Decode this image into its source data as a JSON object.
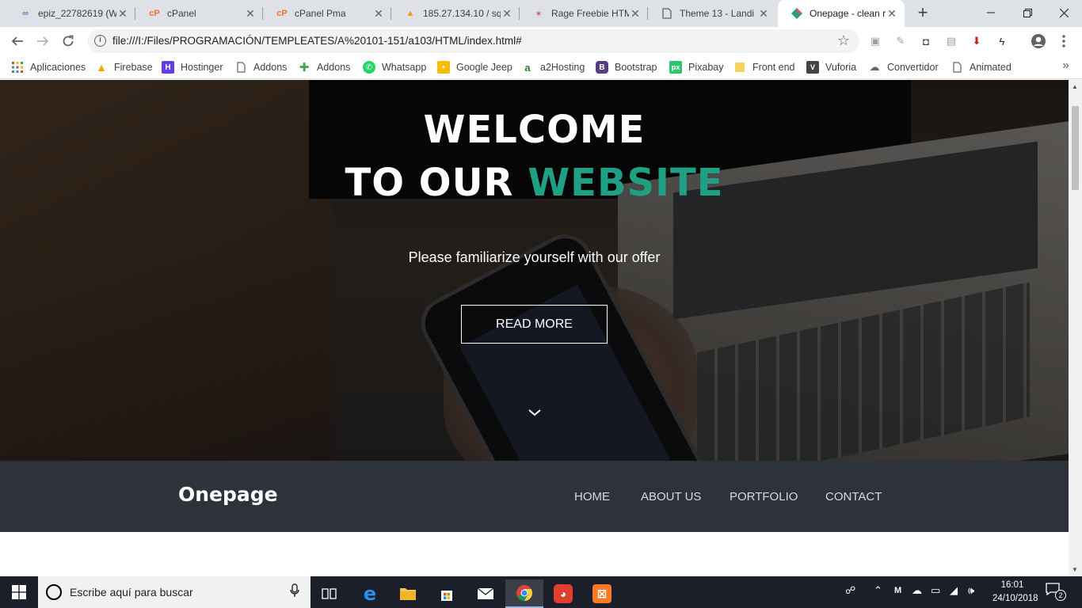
{
  "browser": {
    "tabs": [
      {
        "title": "epiz_22782619 (W",
        "icon": "infinity-icon",
        "icon_color": "#7b6fd6"
      },
      {
        "title": "cPanel",
        "icon": "cpanel-icon",
        "icon_color": "#ff6c2c"
      },
      {
        "title": "cPanel Pma",
        "icon": "cpanel-icon",
        "icon_color": "#ff6c2c"
      },
      {
        "title": "185.27.134.10 / sq",
        "icon": "phpmyadmin-icon",
        "icon_color": "#f89c0e"
      },
      {
        "title": "Rage Freebie HTM",
        "icon": "rage-icon",
        "icon_color": "#c44b9a"
      },
      {
        "title": "Theme 13 - Landi",
        "icon": "document-icon",
        "icon_color": "#5f6368"
      },
      {
        "title": "Onepage - clean r",
        "icon": "onepage-icon",
        "icon_color": "#1f9f83"
      }
    ],
    "active_tab_index": 6,
    "new_tab_symbol": "+",
    "address": "file:///I:/Files/PROGRAMACIÓN/TEMPLEATES/A%20101-151/a103/HTML/index.html#",
    "bookmarks": [
      {
        "label": "Aplicaciones",
        "icon": "apps-grid-icon",
        "color": "#4285f4"
      },
      {
        "label": "Firebase",
        "icon": "firebase-icon",
        "color": "#ffa000"
      },
      {
        "label": "Hostinger",
        "icon": "hostinger-icon",
        "color": "#673de6"
      },
      {
        "label": "Addons",
        "icon": "page-icon",
        "color": "#5f6368"
      },
      {
        "label": "Addons",
        "icon": "puzzle-icon",
        "color": "#3aa757"
      },
      {
        "label": "Whatsapp",
        "icon": "whatsapp-icon",
        "color": "#25d366"
      },
      {
        "label": "Google Jeep",
        "icon": "keep-icon",
        "color": "#fbbc04"
      },
      {
        "label": "a2Hosting",
        "icon": "a2-icon",
        "color": "#2e7d32"
      },
      {
        "label": "Bootstrap",
        "icon": "bootstrap-icon",
        "color": "#563d7c"
      },
      {
        "label": "Pixabay",
        "icon": "pixabay-icon",
        "color": "#2ec66d"
      },
      {
        "label": "Front end",
        "icon": "folder-icon",
        "color": "#f4d35e"
      },
      {
        "label": "Vuforia",
        "icon": "vuforia-icon",
        "color": "#444444"
      },
      {
        "label": "Convertidor",
        "icon": "cloud-icon",
        "color": "#666666"
      },
      {
        "label": "Animated",
        "icon": "page-icon",
        "color": "#5f6368"
      }
    ],
    "bookmarks_more": "»"
  },
  "page": {
    "hero": {
      "title_line1": "WELCOME",
      "title_line2_plain": "TO OUR ",
      "title_line2_accent": "WEBSITE",
      "subtitle": "Please familiarize yourself with our offer",
      "button": "READ MORE",
      "accent_color": "#1f9f83"
    },
    "navbar": {
      "brand": "Onepage",
      "links": [
        "HOME",
        "ABOUT US",
        "PORTFOLIO",
        "CONTACT"
      ]
    }
  },
  "taskbar": {
    "search_placeholder": "Escribe aquí para buscar",
    "time": "16:01",
    "date": "24/10/2018",
    "notification_count": "2",
    "pinned": [
      "task-view-icon",
      "edge-icon",
      "file-explorer-icon",
      "store-icon",
      "mail-icon",
      "chrome-icon",
      "app-red-icon",
      "xampp-icon"
    ]
  }
}
